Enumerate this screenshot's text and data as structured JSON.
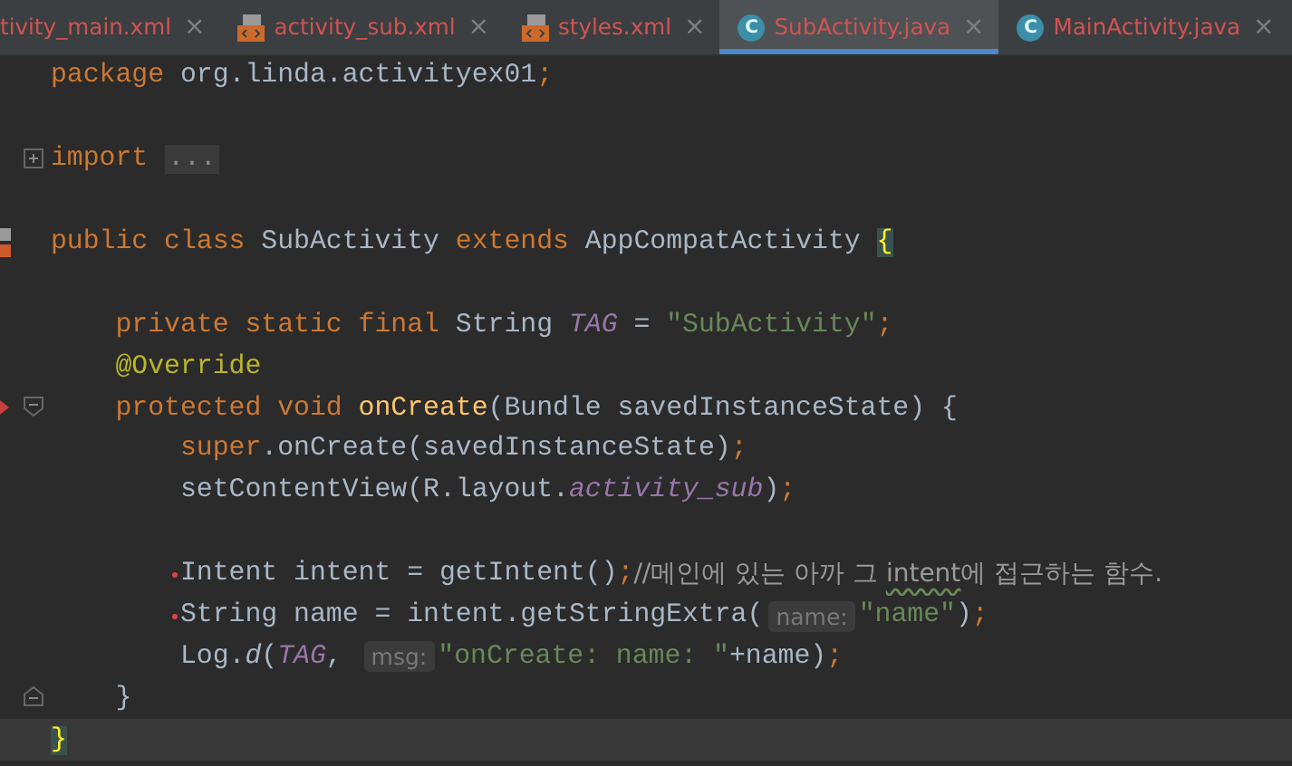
{
  "tabs": [
    {
      "label": "tivity_main.xml",
      "icon": {
        "kind": "none"
      },
      "close": "×",
      "selected": false
    },
    {
      "label": "activity_sub.xml",
      "icon": {
        "kind": "xml"
      },
      "close": "×",
      "selected": false
    },
    {
      "label": "styles.xml",
      "icon": {
        "kind": "xml"
      },
      "close": "×",
      "selected": false
    },
    {
      "label": "SubActivity.java",
      "icon": {
        "kind": "class",
        "letter": "C"
      },
      "close": "×",
      "selected": true
    },
    {
      "label": "MainActivity.java",
      "icon": {
        "kind": "class",
        "letter": "C"
      },
      "close": "×",
      "selected": false
    }
  ],
  "editor": {
    "lines": [
      {
        "tokens": [
          {
            "kind": "kw",
            "text": "package "
          },
          {
            "kind": "plain",
            "text": "org.linda.activityex01"
          },
          {
            "kind": "kw",
            "text": ";"
          }
        ],
        "marked": false,
        "current": false
      },
      {
        "marked": false,
        "current": false
      },
      {
        "tokens": [
          {
            "kind": "kw",
            "text": "import "
          },
          {
            "kind": "folded",
            "text": "..."
          }
        ],
        "fold": {
          "kind": "collapsed"
        },
        "marked": false,
        "current": false
      },
      {
        "marked": false,
        "current": false
      },
      {
        "tokens": [
          {
            "kind": "kw",
            "text": "public class "
          },
          {
            "kind": "plain",
            "text": "SubActivity "
          },
          {
            "kind": "kw",
            "text": "extends "
          },
          {
            "kind": "plain",
            "text": "AppCompatActivity "
          },
          {
            "kind": "brace",
            "text": "{"
          }
        ],
        "marked": false,
        "current": false,
        "gutter_icon": {
          "kind": "class"
        }
      },
      {
        "marked": false,
        "current": false
      },
      {
        "tokens": [
          {
            "kind": "kw",
            "text": "    private static final "
          },
          {
            "kind": "plain",
            "text": "String "
          },
          {
            "kind": "const",
            "text": "TAG"
          },
          {
            "kind": "plain",
            "text": " = "
          },
          {
            "kind": "str",
            "text": "\"SubActivity\""
          },
          {
            "kind": "kw",
            "text": ";"
          }
        ],
        "marked": false,
        "current": false
      },
      {
        "tokens": [
          {
            "kind": "ann",
            "text": "    @Override"
          }
        ],
        "marked": false,
        "current": false
      },
      {
        "tokens": [
          {
            "kind": "kw",
            "text": "    protected void "
          },
          {
            "kind": "fn",
            "text": "onCreate"
          },
          {
            "kind": "plain",
            "text": "(Bundle savedInstanceState) {"
          }
        ],
        "fold": {
          "kind": "open"
        },
        "marked": false,
        "current": false,
        "gutter_icon": {
          "kind": "override"
        }
      },
      {
        "tokens": [
          {
            "kind": "kw",
            "text": "        super"
          },
          {
            "kind": "plain",
            "text": ".onCreate(savedInstanceState)"
          },
          {
            "kind": "kw",
            "text": ";"
          }
        ],
        "marked": false,
        "current": false
      },
      {
        "tokens": [
          {
            "kind": "plain",
            "text": "        setContentView(R.layout."
          },
          {
            "kind": "const",
            "text": "activity_sub"
          },
          {
            "kind": "plain",
            "text": ")"
          },
          {
            "kind": "kw",
            "text": ";"
          }
        ],
        "marked": false,
        "current": false
      },
      {
        "marked": false,
        "current": false
      },
      {
        "tokens": [
          {
            "kind": "plain",
            "text": "        Intent intent = getIntent()"
          },
          {
            "kind": "kw",
            "text": ";"
          },
          {
            "kind": "comment",
            "text": "//메인에 있는 아까 그 "
          },
          {
            "kind": "typo",
            "text": "intent"
          },
          {
            "kind": "comment",
            "text": "에 접근하는 함수."
          }
        ],
        "marked": true,
        "current": false
      },
      {
        "tokens": [
          {
            "kind": "plain",
            "text": "        String name = intent.getStringExtra("
          },
          {
            "kind": "hint",
            "text": "name:"
          },
          {
            "kind": "str",
            "text": "\"name\""
          },
          {
            "kind": "plain",
            "text": ")"
          },
          {
            "kind": "kw",
            "text": ";"
          }
        ],
        "marked": true,
        "current": false
      },
      {
        "tokens": [
          {
            "kind": "plain",
            "text": "        Log."
          },
          {
            "kind": "static",
            "text": "d"
          },
          {
            "kind": "plain",
            "text": "("
          },
          {
            "kind": "const",
            "text": "TAG"
          },
          {
            "kind": "plain",
            "text": ", "
          },
          {
            "kind": "hint",
            "text": "msg:"
          },
          {
            "kind": "str",
            "text": "\"onCreate: name: \""
          },
          {
            "kind": "plain",
            "text": "+name)"
          },
          {
            "kind": "kw",
            "text": ";"
          }
        ],
        "marked": false,
        "current": false
      },
      {
        "tokens": [
          {
            "kind": "plain",
            "text": "    }"
          }
        ],
        "fold": {
          "kind": "close"
        },
        "marked": false,
        "current": false
      },
      {
        "tokens": [
          {
            "kind": "brace",
            "text": "}"
          }
        ],
        "marked": false,
        "current": true
      }
    ]
  }
}
